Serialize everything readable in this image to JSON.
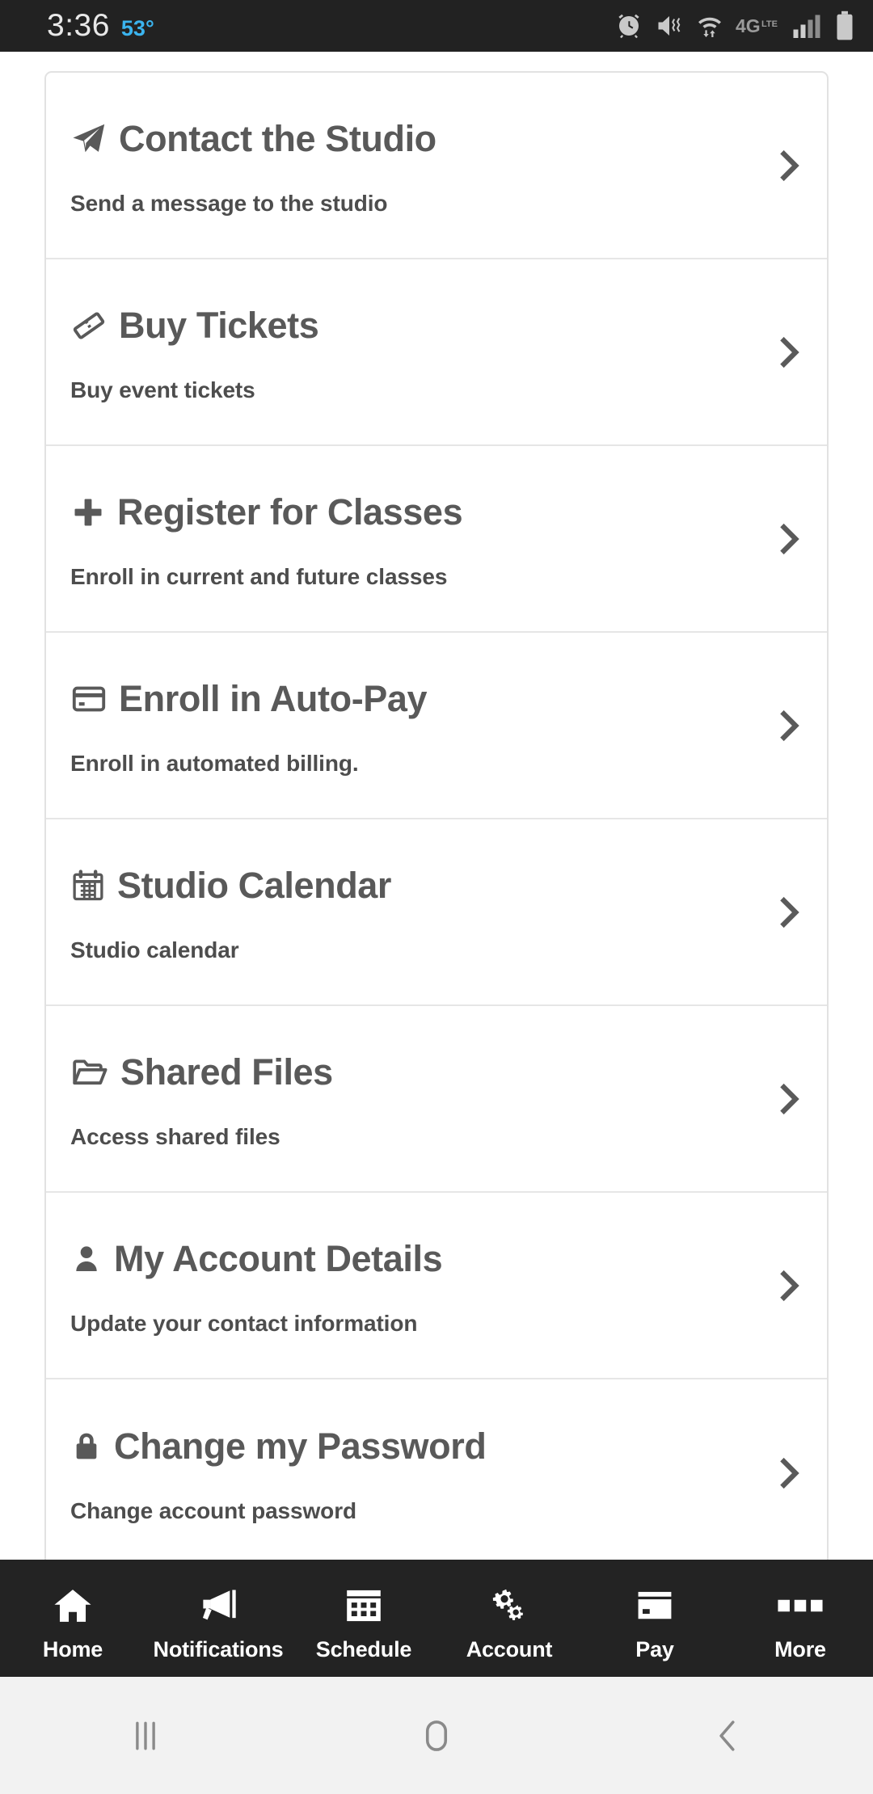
{
  "status_bar": {
    "time": "3:36",
    "temperature": "53°",
    "icons": [
      "alarm-icon",
      "vibrate-mute-icon",
      "wifi-data-icon",
      "4g-lte-icon",
      "signal-bars-icon",
      "battery-icon"
    ],
    "background_color": "#222222",
    "time_color": "#e8e8e8",
    "temp_color": "#3bb4ef"
  },
  "menu": {
    "items": [
      {
        "icon": "paper-plane-icon",
        "title": "Contact the Studio",
        "subtitle": "Send a message to the studio",
        "chevron": "chevron-right-icon"
      },
      {
        "icon": "ticket-icon",
        "title": "Buy Tickets",
        "subtitle": "Buy event tickets",
        "chevron": "chevron-right-icon"
      },
      {
        "icon": "plus-icon",
        "title": "Register for Classes",
        "subtitle": "Enroll in current and future classes",
        "chevron": "chevron-right-icon"
      },
      {
        "icon": "credit-card-icon",
        "title": "Enroll in Auto-Pay",
        "subtitle": "Enroll in automated billing.",
        "chevron": "chevron-right-icon"
      },
      {
        "icon": "calendar-icon",
        "title": "Studio Calendar",
        "subtitle": "Studio calendar",
        "chevron": "chevron-right-icon"
      },
      {
        "icon": "folder-open-icon",
        "title": "Shared Files",
        "subtitle": "Access shared files",
        "chevron": "chevron-right-icon"
      },
      {
        "icon": "user-icon",
        "title": "My Account Details",
        "subtitle": "Update your contact information",
        "chevron": "chevron-right-icon"
      },
      {
        "icon": "lock-icon",
        "title": "Change my Password",
        "subtitle": "Change account password",
        "chevron": "chevron-right-icon"
      }
    ],
    "title_color": "#595959",
    "subtitle_color": "#4d4d4d",
    "card_background": "#ffffff",
    "divider_color": "#e6e6e6"
  },
  "tab_bar": {
    "background_color": "#232323",
    "label_color": "#ffffff",
    "tabs": [
      {
        "icon": "home-icon",
        "label": "Home"
      },
      {
        "icon": "megaphone-icon",
        "label": "Notifications"
      },
      {
        "icon": "calendar-grid-icon",
        "label": "Schedule"
      },
      {
        "icon": "gears-icon",
        "label": "Account"
      },
      {
        "icon": "credit-card-icon",
        "label": "Pay"
      },
      {
        "icon": "three-squares-icon",
        "label": "More"
      }
    ]
  },
  "system_nav": {
    "background_color": "#f2f2f2",
    "icon_color": "#8a8a8a",
    "buttons": [
      {
        "icon": "recents-icon",
        "label": "Recents"
      },
      {
        "icon": "home-circle-icon",
        "label": "Home"
      },
      {
        "icon": "back-icon",
        "label": "Back"
      }
    ]
  }
}
